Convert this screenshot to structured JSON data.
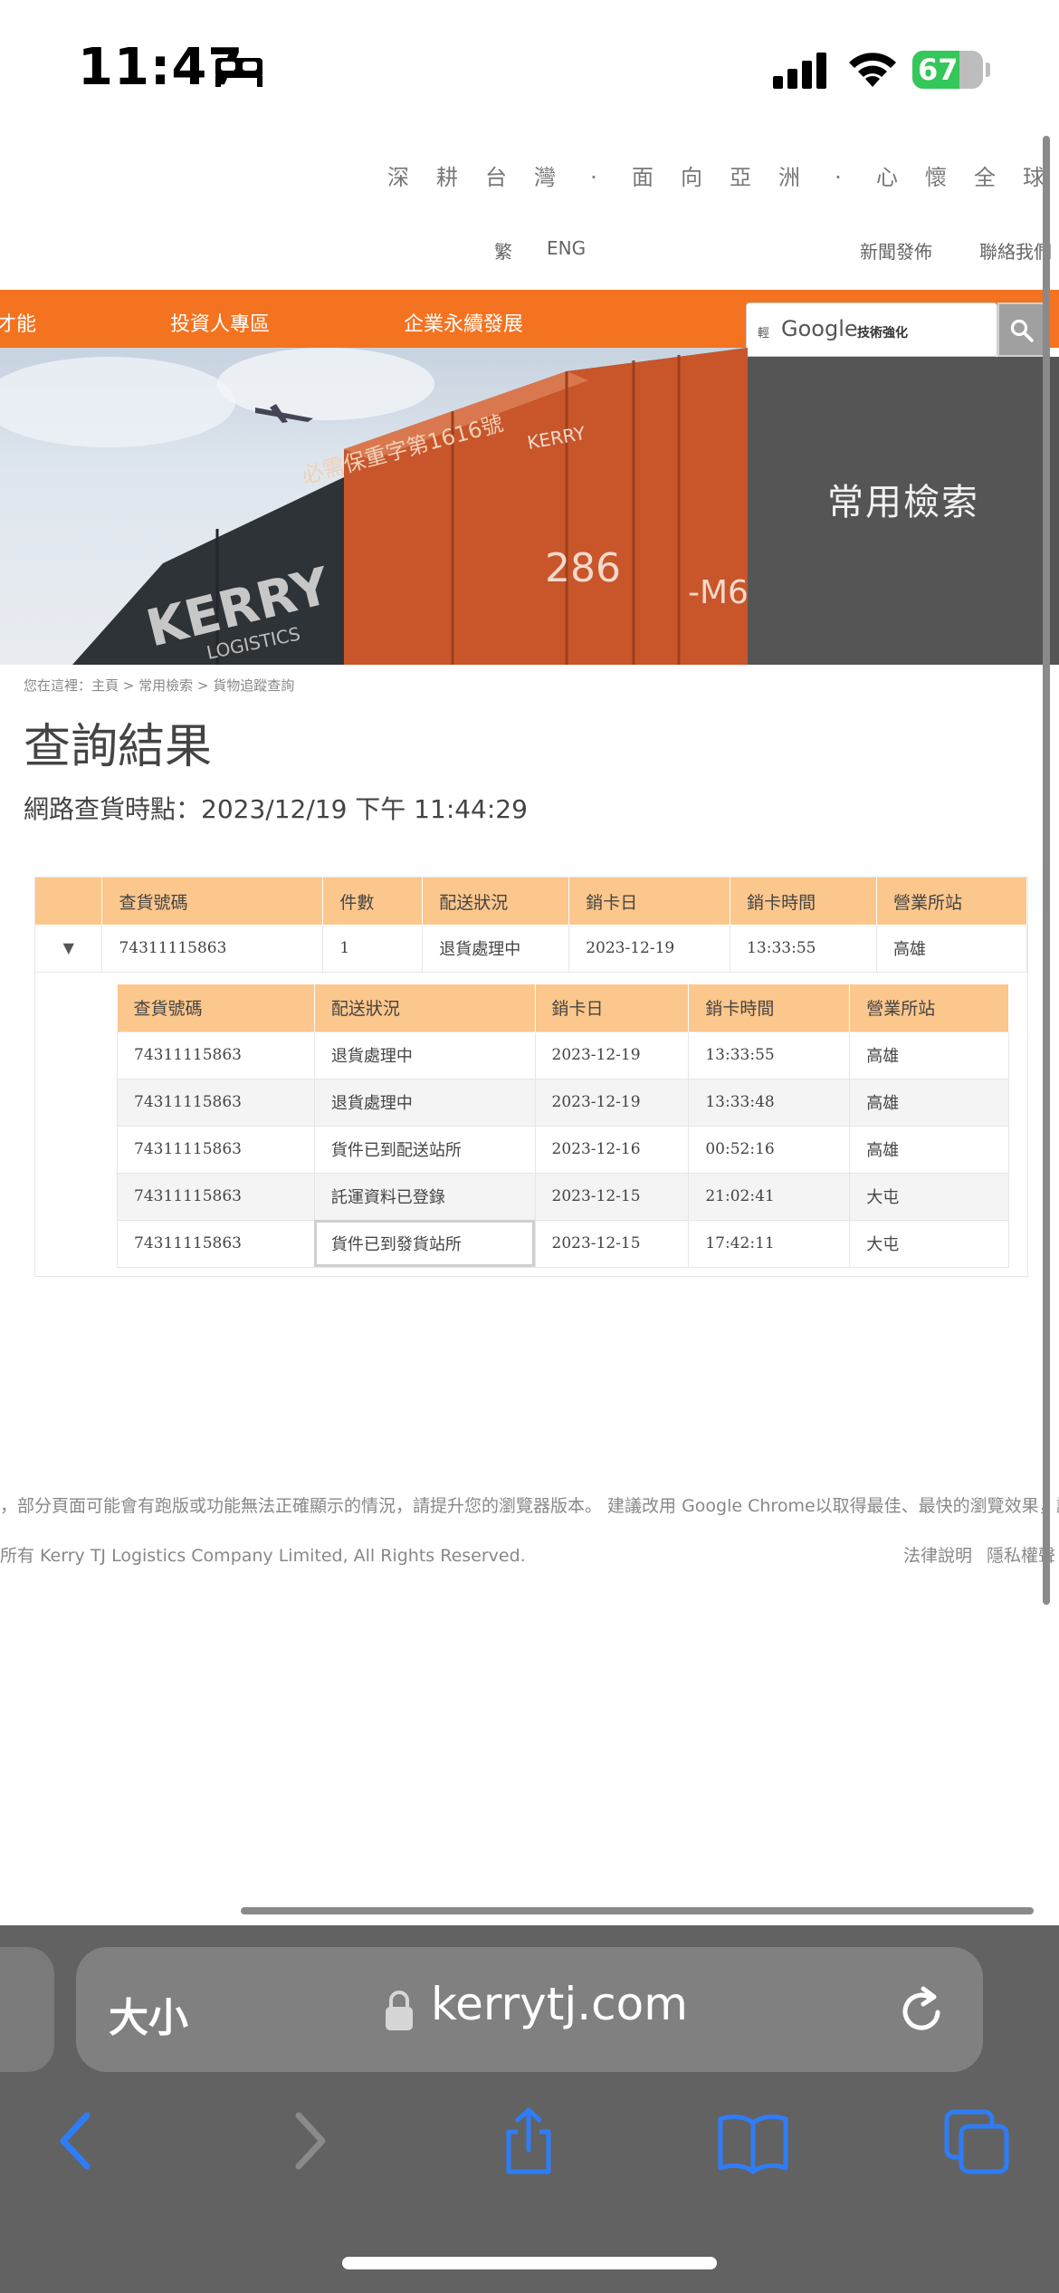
{
  "status_bar": {
    "time": "11:47",
    "battery": "67",
    "battery_level": 0.67
  },
  "header": {
    "slogan": [
      "深",
      "耕",
      "台",
      "灣",
      "·",
      "面",
      "向",
      "亞",
      "洲",
      "·",
      "心",
      "懷",
      "全",
      "球"
    ],
    "lang_trad": "繁",
    "lang_eng": "ENG",
    "news": "新聞發佈",
    "contact": "聯絡我們"
  },
  "nav": {
    "items": [
      "才能",
      "投資人專區",
      "企業永續發展"
    ]
  },
  "search": {
    "prefix": "輕",
    "brand": "Google",
    "suffix": "技術強化"
  },
  "hero": {
    "plate": "必需保重字第1616號",
    "number": "286",
    "suffix": "-M6",
    "logo": "KERRY",
    "logo_sub": "LOGISTICS",
    "side_panel": "常用檢索"
  },
  "page": {
    "breadcrumb": "您在這裡：主頁 > 常用檢索 > 貨物追蹤查詢",
    "title": "查詢結果",
    "query_time": "網路查貨時點：2023/12/19 下午 11:44:29"
  },
  "main_table": {
    "headers": [
      "查貨號碼",
      "件數",
      "配送狀況",
      "銷卡日",
      "銷卡時間",
      "營業所站"
    ],
    "row": {
      "toggle": "▼",
      "tracking": "74311115863",
      "count": "1",
      "status": "退貨處理中",
      "date": "2023-12-19",
      "time": "13:33:55",
      "station": "高雄"
    }
  },
  "detail_table": {
    "headers": [
      "查貨號碼",
      "配送狀況",
      "銷卡日",
      "銷卡時間",
      "營業所站"
    ],
    "rows": [
      {
        "tracking": "74311115863",
        "status": "退貨處理中",
        "date": "2023-12-19",
        "time": "13:33:55",
        "station": "高雄"
      },
      {
        "tracking": "74311115863",
        "status": "退貨處理中",
        "date": "2023-12-19",
        "time": "13:33:48",
        "station": "高雄"
      },
      {
        "tracking": "74311115863",
        "status": "貨件已到配送站所",
        "date": "2023-12-16",
        "time": "00:52:16",
        "station": "高雄"
      },
      {
        "tracking": "74311115863",
        "status": "託運資料已登錄",
        "date": "2023-12-15",
        "time": "21:02:41",
        "station": "大屯"
      },
      {
        "tracking": "74311115863",
        "status": "貨件已到發貨站所",
        "date": "2023-12-15",
        "time": "17:42:11",
        "station": "大屯"
      }
    ]
  },
  "footer": {
    "notice": "，部分頁面可能會有跑版或功能無法正確顯示的情況，請提升您的瀏覽器版本。 建議改用 Google Chrome以取得最佳、最快的瀏覽效果，謝謝。",
    "copyright": "所有 Kerry TJ Logistics Company Limited, All Rights Reserved.",
    "legal": "法律說明",
    "privacy": "隱私權聲"
  },
  "browser": {
    "aa": "大小",
    "url": "kerrytj.com"
  },
  "colors": {
    "orange": "#f47320",
    "table_header": "#fcc78c",
    "safari_blue": "#2f7df6"
  }
}
